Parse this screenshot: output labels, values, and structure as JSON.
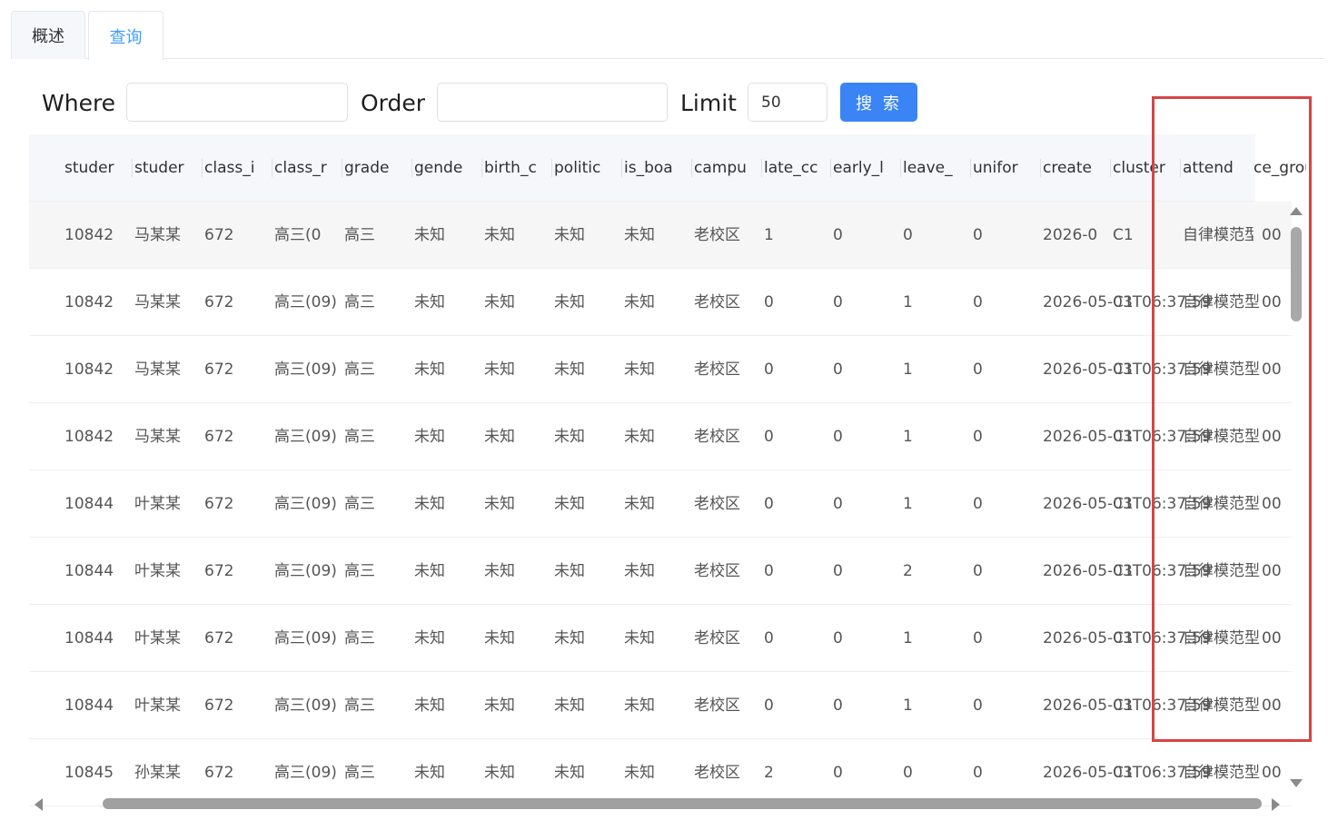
{
  "tabs": [
    {
      "label": "概述",
      "active": false
    },
    {
      "label": "查询",
      "active": true
    }
  ],
  "query": {
    "where_label": "Where",
    "where_value": "",
    "order_label": "Order",
    "order_value": "",
    "limit_label": "Limit",
    "limit_value": "50",
    "search_label": "搜 索"
  },
  "table": {
    "headers": [
      "studer",
      "studer",
      "class_i",
      "class_r",
      "grade",
      "gende",
      "birth_c",
      "politic",
      "is_boa",
      "campu",
      "late_cc",
      "early_l",
      "leave_",
      "unifor",
      "create",
      "cluster",
      "attend",
      "ce_grou"
    ],
    "rows": [
      [
        "10842",
        "马某某",
        "672",
        "高三(0",
        "高三",
        "未知",
        "未知",
        "未知",
        "未知",
        "老校区",
        "1",
        "0",
        "0",
        "0",
        "2026-0",
        "C1",
        "自律模范型",
        "00"
      ],
      [
        "10842",
        "马某某",
        "672",
        "高三(09)",
        "高三",
        "未知",
        "未知",
        "未知",
        "未知",
        "老校区",
        "0",
        "0",
        "1",
        "0",
        "2026-05-03T06:37:59",
        "C1",
        "自律模范型",
        "00"
      ],
      [
        "10842",
        "马某某",
        "672",
        "高三(09)",
        "高三",
        "未知",
        "未知",
        "未知",
        "未知",
        "老校区",
        "0",
        "0",
        "1",
        "0",
        "2026-05-03T06:37:59",
        "C1",
        "自律模范型",
        "00"
      ],
      [
        "10842",
        "马某某",
        "672",
        "高三(09)",
        "高三",
        "未知",
        "未知",
        "未知",
        "未知",
        "老校区",
        "0",
        "0",
        "1",
        "0",
        "2026-05-03T06:37:59",
        "C1",
        "自律模范型",
        "00"
      ],
      [
        "10844",
        "叶某某",
        "672",
        "高三(09)",
        "高三",
        "未知",
        "未知",
        "未知",
        "未知",
        "老校区",
        "0",
        "0",
        "1",
        "0",
        "2026-05-03T06:37:59",
        "C1",
        "自律模范型",
        "00"
      ],
      [
        "10844",
        "叶某某",
        "672",
        "高三(09)",
        "高三",
        "未知",
        "未知",
        "未知",
        "未知",
        "老校区",
        "0",
        "0",
        "2",
        "0",
        "2026-05-03T06:37:59",
        "C1",
        "自律模范型",
        "00"
      ],
      [
        "10844",
        "叶某某",
        "672",
        "高三(09)",
        "高三",
        "未知",
        "未知",
        "未知",
        "未知",
        "老校区",
        "0",
        "0",
        "1",
        "0",
        "2026-05-03T06:37:59",
        "C1",
        "自律模范型",
        "00"
      ],
      [
        "10844",
        "叶某某",
        "672",
        "高三(09)",
        "高三",
        "未知",
        "未知",
        "未知",
        "未知",
        "老校区",
        "0",
        "0",
        "1",
        "0",
        "2026-05-03T06:37:59",
        "C1",
        "自律模范型",
        "00"
      ],
      [
        "10845",
        "孙某某",
        "672",
        "高三(09)",
        "高三",
        "未知",
        "未知",
        "未知",
        "未知",
        "老校区",
        "2",
        "0",
        "0",
        "0",
        "2026-05-03T06:37:59",
        "C1",
        "自律模范型",
        "00"
      ]
    ]
  },
  "colors": {
    "accent": "#409eff",
    "button": "#3a84f5",
    "highlight": "#d64545"
  }
}
